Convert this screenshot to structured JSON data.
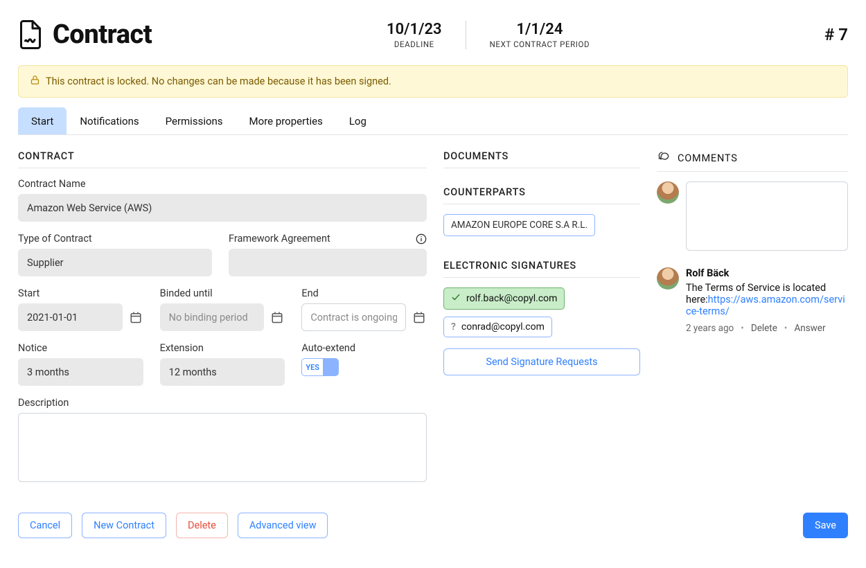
{
  "header": {
    "title": "Contract",
    "deadline_value": "10/1/23",
    "deadline_label": "DEADLINE",
    "next_period_value": "1/1/24",
    "next_period_label": "NEXT CONTRACT PERIOD",
    "hash": "# 7"
  },
  "alert": {
    "text": "This contract is locked. No changes can be made because it has been signed."
  },
  "tabs": {
    "start": "Start",
    "notifications": "Notifications",
    "permissions": "Permissions",
    "more": "More properties",
    "log": "Log"
  },
  "contract": {
    "section": "CONTRACT",
    "name_label": "Contract Name",
    "name_value": "Amazon Web Service (AWS)",
    "type_label": "Type of Contract",
    "type_value": "Supplier",
    "framework_label": "Framework Agreement",
    "framework_value": "",
    "start_label": "Start",
    "start_value": "2021-01-01",
    "binded_label": "Binded until",
    "binded_placeholder": "No binding period",
    "end_label": "End",
    "end_placeholder": "Contract is ongoing",
    "notice_label": "Notice",
    "notice_value": "3 months",
    "extension_label": "Extension",
    "extension_value": "12 months",
    "autoextend_label": "Auto-extend",
    "autoextend_value": "YES",
    "description_label": "Description"
  },
  "documents": {
    "section": "DOCUMENTS"
  },
  "counterparts": {
    "section": "COUNTERPARTS",
    "chip": "AMAZON EUROPE CORE S.A R.L."
  },
  "signatures": {
    "section": "ELECTRONIC SIGNATURES",
    "items": [
      {
        "email": "rolf.back@copyl.com",
        "status": "signed"
      },
      {
        "email": "conrad@copyl.com",
        "status": "pending"
      }
    ],
    "send_button": "Send Signature Requests"
  },
  "comments": {
    "section": "COMMENTS",
    "items": [
      {
        "author": "Rolf Bäck",
        "text_prefix": "The Terms of Service is located here:",
        "link": "https://aws.amazon.com/service-terms/",
        "age": "2 years ago",
        "delete": "Delete",
        "answer": "Answer"
      }
    ]
  },
  "footer": {
    "cancel": "Cancel",
    "new_contract": "New Contract",
    "delete": "Delete",
    "advanced": "Advanced view",
    "save": "Save"
  }
}
